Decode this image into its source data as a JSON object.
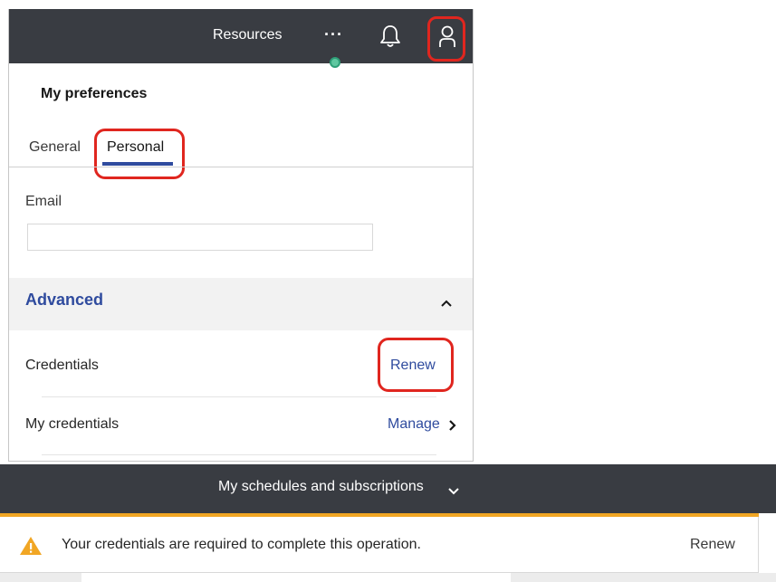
{
  "header": {
    "resources_label": "Resources",
    "more_label": "···"
  },
  "preferences": {
    "title": "My preferences",
    "tabs": [
      {
        "label": "General"
      },
      {
        "label": "Personal"
      }
    ],
    "email": {
      "label": "Email",
      "value": "",
      "placeholder": ""
    },
    "advanced": {
      "title": "Advanced",
      "rows": [
        {
          "label": "Credentials",
          "action": "Renew"
        },
        {
          "label": "My credentials",
          "action": "Manage"
        }
      ]
    }
  },
  "schedules": {
    "label": "My schedules and subscriptions"
  },
  "warning": {
    "message": "Your credentials are required to complete this operation.",
    "action": "Renew"
  },
  "colors": {
    "topbar": "#393c42",
    "accent_blue": "#2f4b9e",
    "highlight_red": "#e0261f",
    "warning_orange": "#f1a624",
    "status_green": "#5fc7a0"
  },
  "icons": [
    "more-icon",
    "bell-icon",
    "user-icon",
    "chevron-up-icon",
    "chevron-right-icon",
    "chevron-down-icon",
    "warning-icon"
  ]
}
